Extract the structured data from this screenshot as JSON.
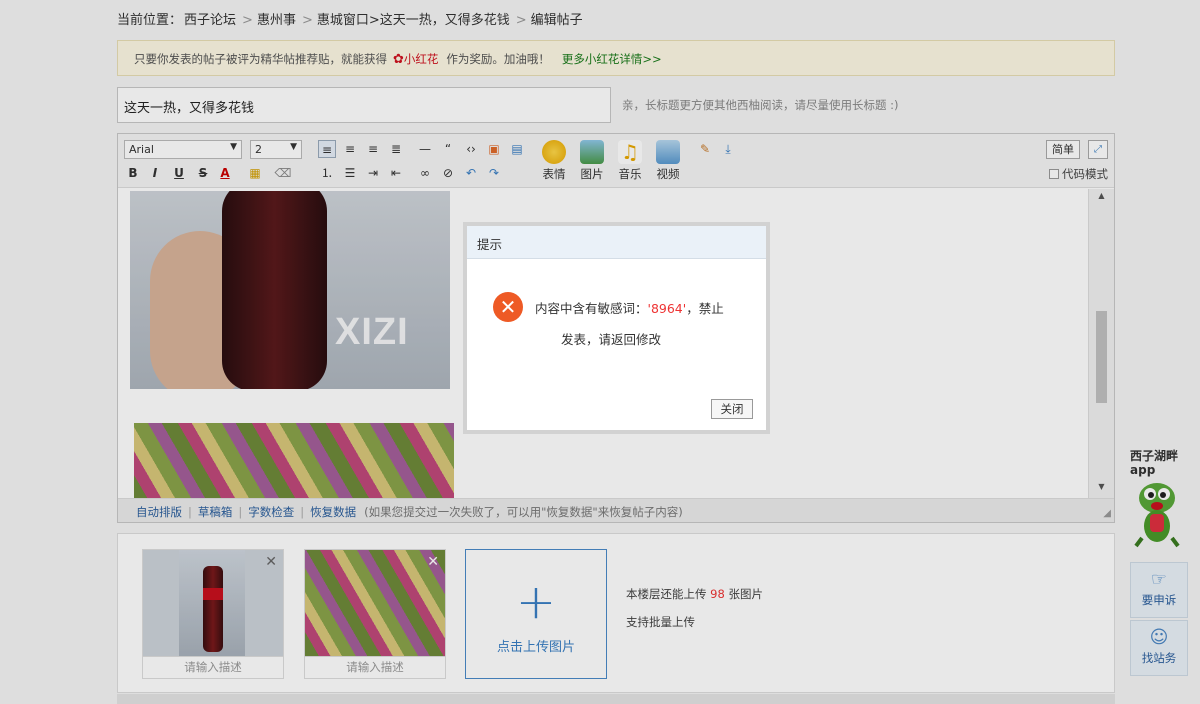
{
  "breadcrumb": {
    "prefix": "当前位置：",
    "items": [
      "西子论坛",
      "惠州事",
      "惠城窗口>这天一热，又得多花钱",
      "编辑帖子"
    ]
  },
  "notice": {
    "text": "只要你发表的帖子被评为精华帖推荐贴，就能获得",
    "flower_icon": "flower-icon",
    "reward": "小红花",
    "suffix": "作为奖励。加油哦！",
    "more_link": "更多小红花详情>>"
  },
  "title": {
    "value": "这天一热，又得多花钱",
    "hint": "亲，长标题更方便其他西柚阅读，请尽量使用长标题 :)"
  },
  "toolbar": {
    "font_family": "Arial",
    "font_size": "2",
    "buttons": {
      "emoji": "表情",
      "image": "图片",
      "music": "音乐",
      "video": "视频"
    },
    "simple": "简单",
    "code_mode": "代码模式"
  },
  "editor": {
    "watermark": "XIZI",
    "statusbar": {
      "links": [
        "自动排版",
        "草稿箱",
        "字数检查",
        "恢复数据"
      ],
      "hint": "(如果您提交过一次失败了，可以用\"恢复数据\"来恢复帖子内容)"
    }
  },
  "dialog": {
    "title": "提示",
    "msg_prefix": "内容中含有敏感词：",
    "keyword": "'8964'",
    "msg_suffix": "，禁止",
    "msg_line2": "发表，请返回修改",
    "close": "关闭"
  },
  "upload": {
    "thumbs": [
      {
        "desc": "请输入描述"
      },
      {
        "desc": "请输入描述"
      }
    ],
    "add_label": "点击上传图片",
    "remaining_prefix": "本楼层还能上传",
    "remaining_count": "98",
    "remaining_suffix": "张图片",
    "batch": "支持批量上传"
  },
  "side": {
    "app_line1": "西子湖畔",
    "app_line2": "app",
    "complain": "要申诉",
    "find_admin": "找站务"
  }
}
